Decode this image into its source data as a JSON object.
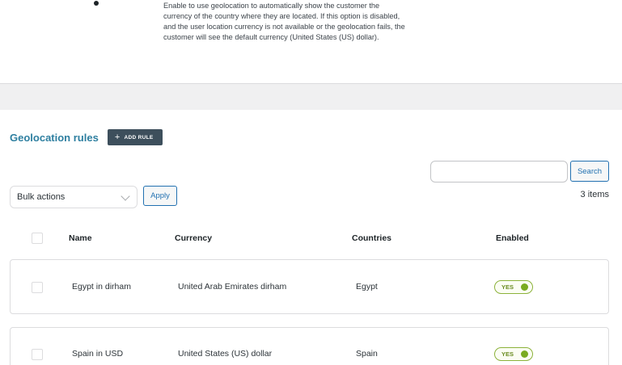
{
  "description": {
    "text": "Enable to use geolocation to automatically show the customer the currency of the country where they are located. If this option is disabled, and the user location currency is not available or the geolocation fails, the customer will see the default currency (United States (US) dollar)."
  },
  "rules": {
    "title": "Geolocation rules",
    "add_rule_label": "ADD RULE"
  },
  "search": {
    "value": "",
    "placeholder": "",
    "button_label": "Search"
  },
  "bulk": {
    "selected": "Bulk actions",
    "apply_label": "Apply"
  },
  "items_count": "3 items",
  "table": {
    "headers": {
      "name": "Name",
      "currency": "Currency",
      "countries": "Countries",
      "enabled": "Enabled"
    },
    "rows": [
      {
        "name": "Egypt in dirham",
        "currency": "United Arab Emirates dirham",
        "countries": "Egypt",
        "enabled": "YES"
      },
      {
        "name": "Spain in USD",
        "currency": "United States (US) dollar",
        "countries": "Spain",
        "enabled": "YES"
      }
    ]
  },
  "colors": {
    "accent": "#2e7fa0",
    "button_dark": "#3d4f5c",
    "link_blue": "#2271b1",
    "enabled_green": "#7aab21"
  }
}
